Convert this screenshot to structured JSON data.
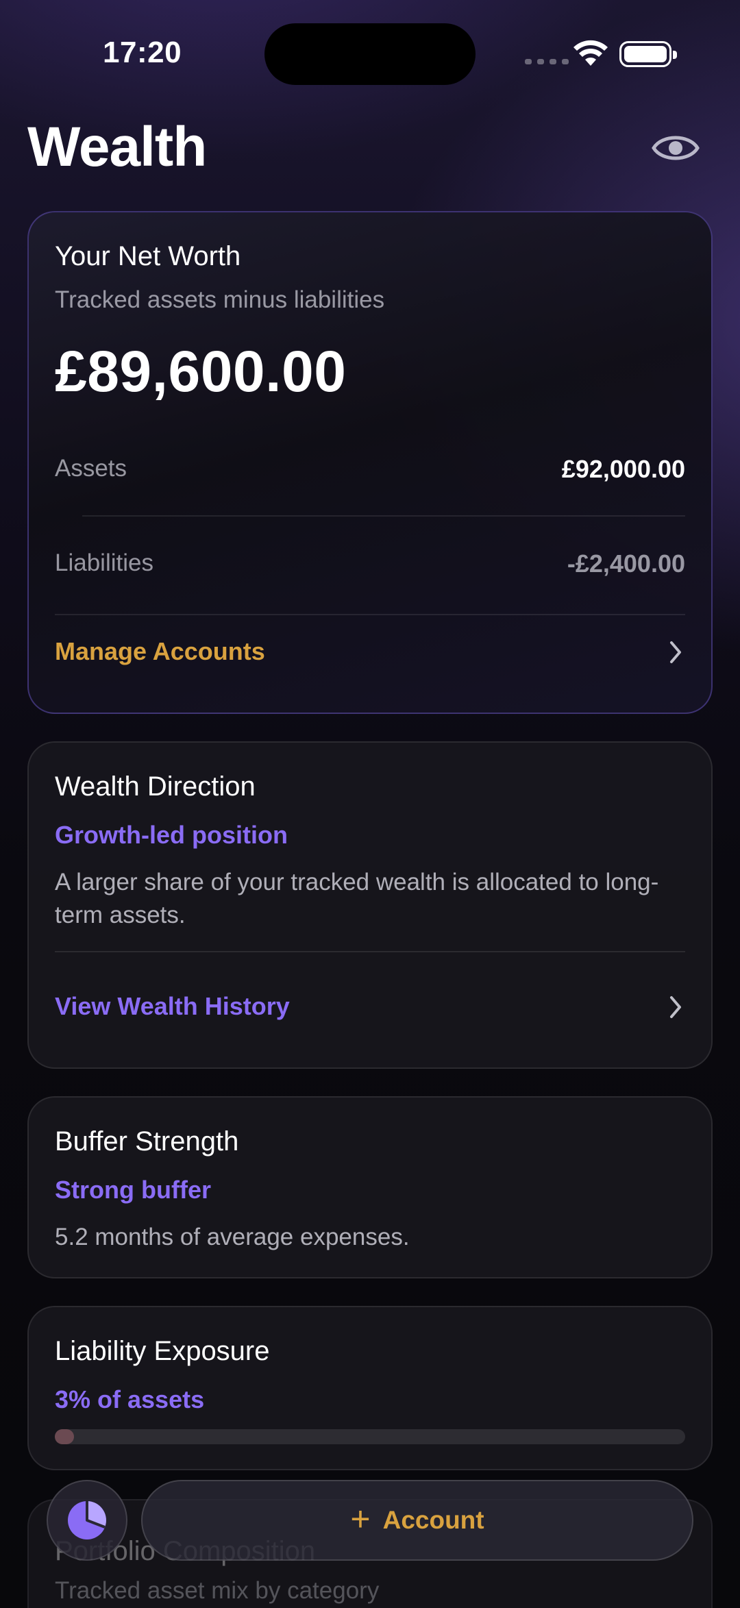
{
  "status_bar": {
    "time": "17:20"
  },
  "page": {
    "title": "Wealth",
    "privacy_icon": "eye-icon"
  },
  "net_worth": {
    "title": "Your Net Worth",
    "subtitle": "Tracked assets minus liabilities",
    "amount": "£89,600.00",
    "assets_label": "Assets",
    "assets_value": "£92,000.00",
    "liabilities_label": "Liabilities",
    "liabilities_value": "-£2,400.00",
    "manage_label": "Manage Accounts"
  },
  "direction": {
    "title": "Wealth Direction",
    "status": "Growth-led position",
    "description": "A larger share of your tracked wealth is allocated to long-term assets.",
    "history_label": "View Wealth History"
  },
  "buffer": {
    "title": "Buffer Strength",
    "status": "Strong buffer",
    "description": "5.2 months of average expenses."
  },
  "liability": {
    "title": "Liability Exposure",
    "status": "3% of assets",
    "progress_percent": 3
  },
  "portfolio": {
    "title": "Portfolio Composition",
    "subtitle": "Tracked asset mix by category"
  },
  "bottom_bar": {
    "add_label": "Account",
    "chart_icon": "pie-chart-icon"
  },
  "colors": {
    "gold": "#d9a23f",
    "purple": "#8a6cf5",
    "liability_bar": "#6b4a52"
  }
}
